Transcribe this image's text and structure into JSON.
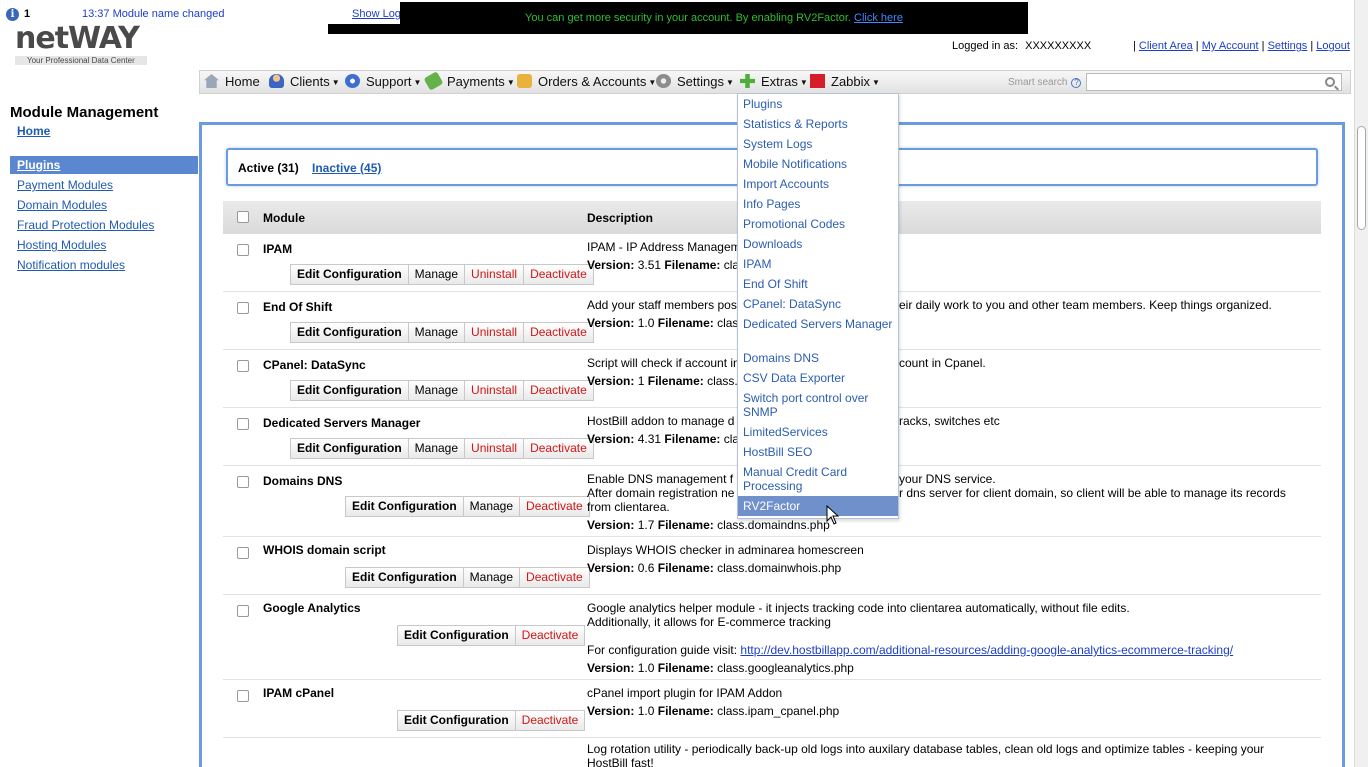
{
  "notifications": {
    "count": "1",
    "message": "13:37 Module name changed",
    "show_log": "Show Log"
  },
  "security_banner": {
    "text": "You can get more security in your account. By enabling RV2Factor.",
    "link": "Click here"
  },
  "logo": {
    "brand_net": "net",
    "brand_way": "WAY",
    "tagline": "Your Professional Data Center"
  },
  "user": {
    "logged_in_label": "Logged in as:",
    "username": "XXXXXXXXX",
    "links": [
      "Client Area",
      "My Account",
      "Settings",
      "Logout"
    ]
  },
  "menu": {
    "items": [
      {
        "label": "Home",
        "icon": "home-icon"
      },
      {
        "label": "Clients",
        "icon": "clients-icon"
      },
      {
        "label": "Support",
        "icon": "support-icon"
      },
      {
        "label": "Payments",
        "icon": "payments-icon"
      },
      {
        "label": "Orders & Accounts",
        "icon": "orders-icon"
      },
      {
        "label": "Settings",
        "icon": "settings-icon"
      },
      {
        "label": "Extras",
        "icon": "extras-icon"
      },
      {
        "label": "Zabbix",
        "icon": "zabbix-icon"
      }
    ],
    "smart_search_label": "Smart search",
    "smart_search_value": ""
  },
  "sidebar": {
    "title": "Module Management",
    "home": "Home",
    "items": [
      "Plugins",
      "Payment Modules",
      "Domain Modules",
      "Fraud Protection Modules",
      "Hosting Modules",
      "Notification modules"
    ],
    "active": "Plugins"
  },
  "tabs": {
    "active": "Active (31)",
    "inactive": "Inactive (45)"
  },
  "table": {
    "col_module": "Module",
    "col_description": "Description",
    "buttons": {
      "edit": "Edit Configuration",
      "manage": "Manage",
      "uninstall": "Uninstall",
      "deactivate": "Deactivate"
    },
    "version_label": "Version:",
    "filename_label": "Filename:",
    "rows": [
      {
        "name": "IPAM",
        "desc": "IPAM - IP Address Managem",
        "version": "3.51",
        "filename": "class"
      },
      {
        "name": "End Of Shift",
        "desc": "Add your staff members pos",
        "desc2": "eir daily work to you and other team members. Keep things organized.",
        "version": "1.0",
        "filename": "class.e"
      },
      {
        "name": "CPanel: DataSync",
        "desc": "Script will check if account in",
        "desc2": "count in Cpanel.",
        "version": "1",
        "filename": "class.cp"
      },
      {
        "name": "Dedicated Servers Manager",
        "desc": "HostBill addon to manage d",
        "desc2": "racks, switches etc",
        "version": "4.31",
        "filename": "class"
      },
      {
        "name": "Domains DNS",
        "desc": "Enable DNS management f",
        "desc2": "your DNS service.",
        "desc3": "After domain registration ne",
        "desc4": "r dns server for client domain, so client will be able to manage its records",
        "desc5": "from clientarea.",
        "version": "1.7",
        "filename": "class.domaindns.php"
      },
      {
        "name": "WHOIS domain script",
        "desc": "Displays WHOIS checker in adminarea homescreen",
        "version": "0.6",
        "filename": "class.domainwhois.php"
      },
      {
        "name": "Google Analytics",
        "desc": "Google analytics helper module - it injects tracking code into clientarea automatically, without file edits.",
        "desc2": "Additionally, it allows for E-commerce tracking",
        "guide_label": "For configuration guide visit:",
        "guide_link": "http://dev.hostbillapp.com/additional-resources/adding-google-analytics-ecommerce-tracking/",
        "version": "1.0",
        "filename": "class.googleanalytics.php"
      },
      {
        "name": "IPAM cPanel",
        "desc": "cPanel import plugin for IPAM Addon",
        "version": "1.0",
        "filename": "class.ipam_cpanel.php"
      },
      {
        "name": "",
        "desc": "Log rotation utility - periodically back-up old logs into auxilary database tables, clean old logs and optimize tables - keeping your",
        "desc2": "HostBill fast!"
      }
    ]
  },
  "extras_dropdown": {
    "items": [
      "Plugins",
      "Statistics & Reports",
      "System Logs",
      "Mobile Notifications",
      "Import Accounts",
      "Info Pages",
      "Promotional Codes",
      "Downloads",
      "IPAM",
      "End Of Shift",
      "CPanel: DataSync",
      "Dedicated Servers Manager",
      "Domains DNS",
      "CSV Data Exporter",
      "Switch port control over SNMP",
      "LimitedServices",
      "HostBill SEO",
      "Manual Credit Card Processing",
      "RV2Factor"
    ],
    "hovered": "RV2Factor"
  }
}
